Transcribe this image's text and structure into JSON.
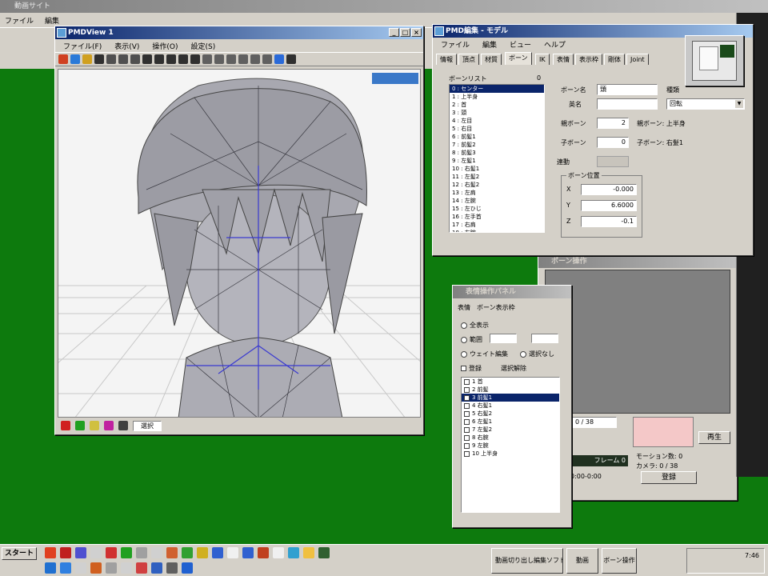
{
  "desktop": {
    "background": "#0d7a0d"
  },
  "top_app": {
    "title": "動画サイト",
    "menu_items": [
      "ファイル",
      "編集"
    ]
  },
  "pmd_view": {
    "title": "PMDView 1",
    "menu": [
      "ファイル(F)",
      "表示(V)",
      "操作(O)",
      "設定(S)"
    ],
    "tools": [
      "#d04020",
      "#2a7ad8",
      "#d0a020",
      "#303030",
      "#505050",
      "#505050",
      "#505050",
      "#303030",
      "#303030",
      "#303030",
      "#303030",
      "#303030",
      "#606060",
      "#606060",
      "#606060",
      "#606060",
      "#606060",
      "#606060",
      "#2a6ad8",
      "#303030"
    ],
    "status_text": "選択"
  },
  "pmd_editor": {
    "title": "PMD編集 - モデル",
    "menu": [
      "ファイル",
      "編集",
      "ビュー",
      "ヘルプ"
    ],
    "tabs": [
      "情報",
      "頂点",
      "材質",
      "ボーン",
      "IK",
      "表情",
      "表示枠",
      "剛体",
      "Joint"
    ],
    "active_tab": "ボーン",
    "list_header": "ボーンリスト",
    "list_count": "0",
    "bones": [
      "0 : センター",
      "1 : 上半身",
      "2 : 首",
      "3 : 頭",
      "4 : 左目",
      "5 : 右目",
      "6 : 前髪1",
      "7 : 前髪2",
      "8 : 前髪3",
      "9 : 左髪1",
      "10 : 右髪1",
      "11 : 左髪2",
      "12 : 右髪2",
      "13 : 左肩",
      "14 : 左腕",
      "15 : 左ひじ",
      "16 : 左手首",
      "17 : 右肩",
      "18 : 右腕",
      "19 : 右ひじ"
    ],
    "selected_bone": 0,
    "labels": {
      "name": "ボーン名",
      "eng": "英名",
      "parent": "親ボーン",
      "parent_link": "親ボーン: 上半身",
      "child": "子ボーン",
      "child_link": "子ボーン: 右髪1",
      "kind_label": "種類",
      "kind_value": "回転",
      "link": "連動",
      "pos_label": "ボーン位置",
      "x": "X",
      "y": "Y",
      "z": "Z"
    },
    "values": {
      "name": "頭",
      "eng": "",
      "parent": "2",
      "child": "0",
      "link_value": "",
      "x": "-0.000",
      "y": "6.6000",
      "z": "-0.1"
    }
  },
  "morph_panel": {
    "title": "表情操作パネル",
    "tabs": [
      "表情",
      "ボーン表示枠"
    ],
    "options": [
      "全表示",
      "範囲",
      "ウェイト編集",
      "選択なし",
      "登録",
      "選択解除"
    ],
    "items": [
      "1 首",
      "2 前髪",
      "3 前髪1",
      "4 右髪1",
      "5 右髪2",
      "6 左髪1",
      "7 左髪2",
      "8 右腕",
      "9 左腕",
      "10 上半身"
    ],
    "selected_item": 2
  },
  "back_win": {
    "title": "ボーン操作",
    "frame_value": "0 / 38",
    "time_label": "フレーム 0",
    "play_label": "再生",
    "info1": "モーション数: 0",
    "info2": "カメラ: 0 / 38",
    "stat": "0:00-0:00",
    "register_label": "登録"
  },
  "taskbar": {
    "start": "スタート",
    "tasks": [
      "動画切り出し編集ソフト",
      "動画",
      "ボーン操作"
    ],
    "clock": "7:46",
    "icons_row1": [
      "#e04020",
      "#c02020",
      "#5050d0",
      "#d0d0d0",
      "#d03030",
      "#20a020",
      "#a0a0a0",
      "#d0d0d0",
      "#d06030",
      "#30a030",
      "#d0b020",
      "#3060d0",
      "#f0f0f0",
      "#3060d0",
      "#c04020",
      "#f0f0f0",
      "#30a0d0",
      "#f0c040",
      "#306030"
    ],
    "icons_row2": [
      "#2070d0",
      "#3080e0",
      "#d0d0d0",
      "#d06020",
      "#a0a0a0",
      "#d0d0d0",
      "#d04040",
      "#3060c0",
      "#606060",
      "#2060d0"
    ]
  }
}
